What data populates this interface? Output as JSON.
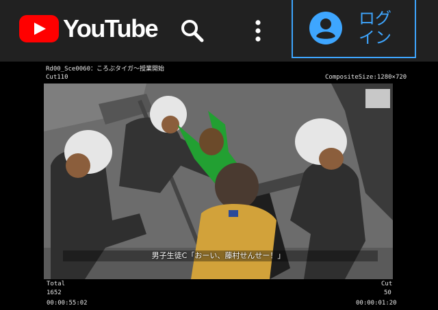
{
  "header": {
    "logo_text": "YouTube",
    "login_label": "ログイン",
    "colors": {
      "bar": "#212121",
      "brand_red": "#ff0000",
      "accent": "#3ea6ff"
    },
    "icons": [
      "youtube-logo-icon",
      "search-icon",
      "more-vert-icon",
      "account-circle-icon"
    ]
  },
  "video": {
    "scene_title": "Rd00_Sce0060：ころぶタイガ～授業開始",
    "cut_label": "Cut110",
    "composite_size": "CompositeSize:1280×720",
    "subtitle": "男子生徒C「おーい、藤村せんせー！」",
    "total_label": "Total",
    "total_frames": "1652",
    "total_time": "00:00:55:02",
    "cut_counter_label": "Cut",
    "cut_frames": "50",
    "cut_time": "00:00:01:20"
  }
}
